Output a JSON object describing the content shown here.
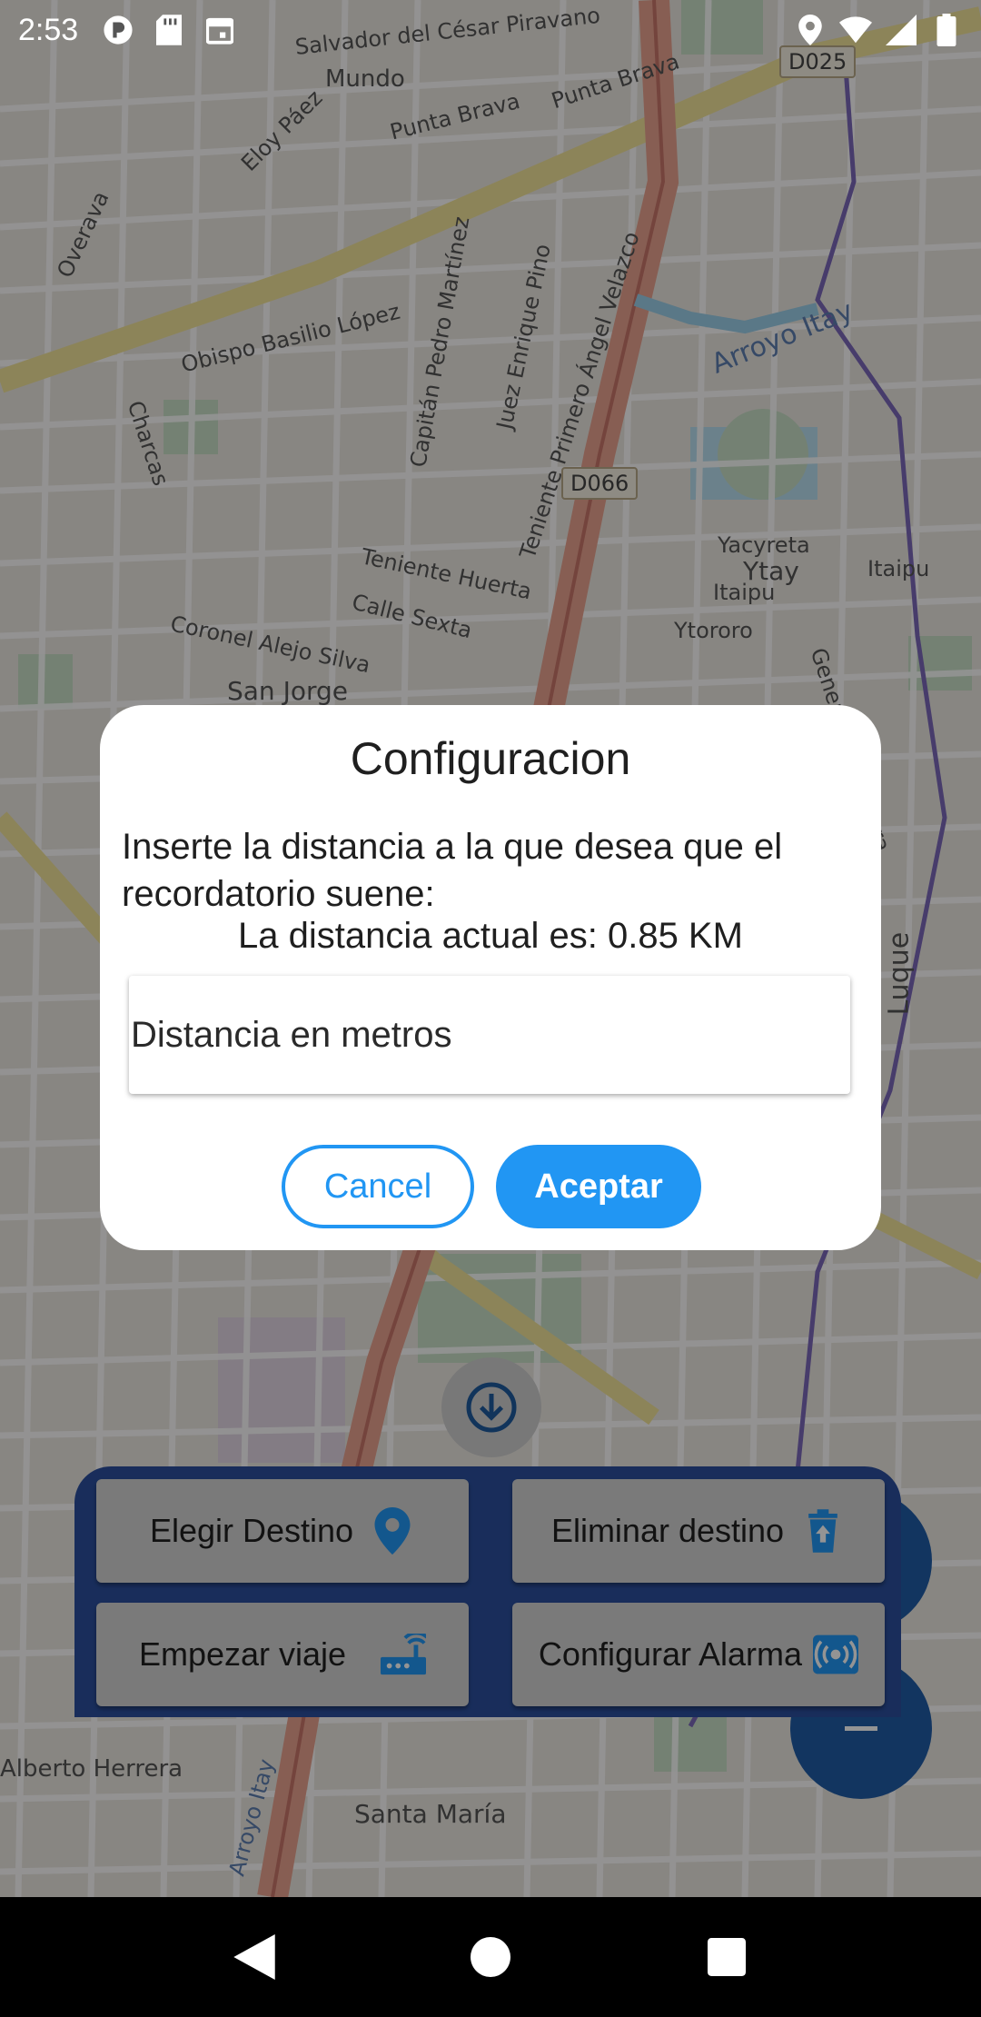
{
  "status_bar": {
    "time": "2:53",
    "icons": [
      "notification-app-icon",
      "sd-card-icon",
      "calendar-icon",
      "location-icon",
      "wifi-icon",
      "signal-icon",
      "battery-icon"
    ]
  },
  "map": {
    "labels": [
      {
        "text": "Salvador del César Piravano"
      },
      {
        "text": "Mundo"
      },
      {
        "text": "Punta Brava"
      },
      {
        "text": "Punta Brava"
      },
      {
        "text": "Eloy Páez"
      },
      {
        "text": "Overava"
      },
      {
        "text": "Obispo Basilio López"
      },
      {
        "text": "Charcas"
      },
      {
        "text": "Capitán Pedro Martínez"
      },
      {
        "text": "Juez Enrique Pino"
      },
      {
        "text": "Teniente Primero Ángel Velazco"
      },
      {
        "text": "Arroyo Itay"
      },
      {
        "text": "Teniente Huerta"
      },
      {
        "text": "Calle Sexta"
      },
      {
        "text": "Coronel Alejo Silva"
      },
      {
        "text": "San Jorge"
      },
      {
        "text": "Yacyreta"
      },
      {
        "text": "Ytay"
      },
      {
        "text": "Itaipu"
      },
      {
        "text": "Ytororo"
      },
      {
        "text": "General Adrian Jara"
      },
      {
        "text": "Itaipu"
      },
      {
        "text": "Luque"
      },
      {
        "text": "Santa María"
      },
      {
        "text": "Alberto Herrera"
      },
      {
        "text": "Arroyo Itay"
      }
    ],
    "shields": [
      "D025",
      "D066"
    ]
  },
  "dialog": {
    "title": "Configuracion",
    "message": "Inserte la distancia a la que desea que el recordatorio suene:",
    "current_distance": "La distancia actual es: 0.85 KM",
    "input_placeholder": "Distancia en metros",
    "input_value": "",
    "cancel_label": "Cancel",
    "accept_label": "Aceptar"
  },
  "panel": {
    "choose_destination": "Elegir Destino",
    "delete_destination": "Eliminar destino",
    "start_trip": "Empezar viaje",
    "configure_alarm": "Configurar Alarma"
  },
  "colors": {
    "accent": "#2196f3",
    "panel": "#2b4f9e",
    "scrim": "rgba(0,0,0,0.42)"
  }
}
